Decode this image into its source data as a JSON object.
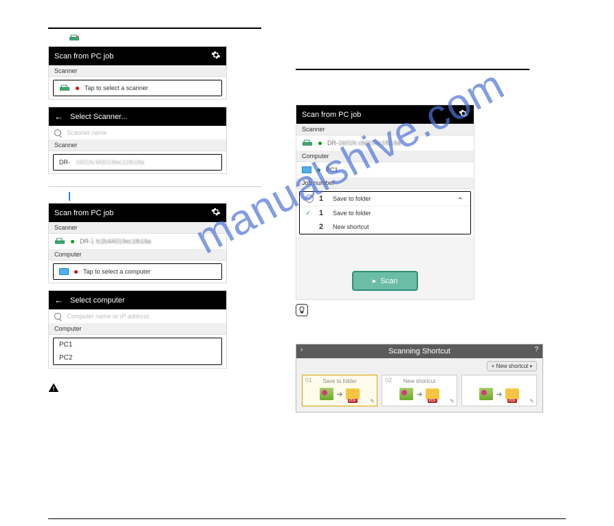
{
  "watermark": "manualshive.com",
  "left": {
    "p1": {
      "title": "Scan from PC job",
      "scannerLabel": "Scanner",
      "tapScanner": "Tap to select a scanner"
    },
    "sel1": {
      "title": "Select Scanner...",
      "placeholder": "Scanner name",
      "scannerLabel": "Scanner",
      "scannerItem": "DR-"
    },
    "p2": {
      "title": "Scan from PC job",
      "scannerLabel": "Scanner",
      "scannerName": "DR-",
      "computerLabel": "Computer",
      "tapComputer": "Tap to select a computer"
    },
    "sel2": {
      "title": "Select computer",
      "placeholder": "Computer name or IP address",
      "computerLabel": "Computer",
      "pcs": [
        "PC1",
        "PC2"
      ]
    }
  },
  "right": {
    "title": "Scan from PC job",
    "scannerLabel": "Scanner",
    "scannerName": "DR-",
    "computerLabel": "Computer",
    "pcName": "PC1",
    "jobLabel": "Job number",
    "jobs": [
      {
        "num": "1",
        "name": "Save to folder"
      },
      {
        "num": "1",
        "name": "Save to folder"
      },
      {
        "num": "2",
        "name": "New shortcut"
      }
    ],
    "scanBtn": "Scan"
  },
  "shortcut": {
    "title": "Scanning Shortcut",
    "newBtn": "New shortcut",
    "cards": [
      {
        "num": "01",
        "title": "Save to folder"
      },
      {
        "num": "02",
        "title": "New shortcut"
      },
      {
        "num": "",
        "title": ""
      }
    ]
  }
}
